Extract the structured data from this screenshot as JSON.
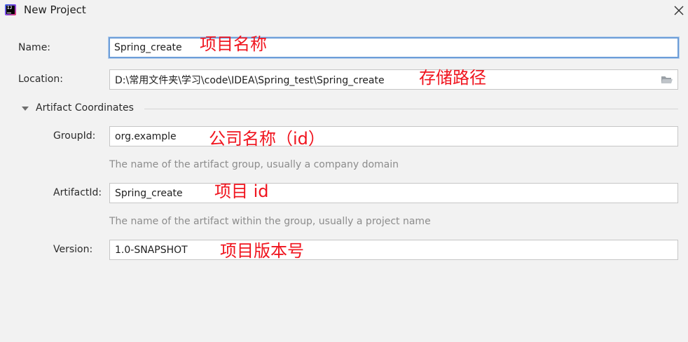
{
  "window": {
    "title": "New Project",
    "app_icon_text": "IJ"
  },
  "form": {
    "name": {
      "label": "Name:",
      "value": "Spring_create"
    },
    "location": {
      "label": "Location:",
      "value": "D:\\常用文件夹\\学习\\code\\IDEA\\Spring_test\\Spring_create"
    },
    "artifact_section": {
      "title": "Artifact Coordinates",
      "expanded": true,
      "group_id": {
        "label": "GroupId:",
        "value": "org.example",
        "hint": "The name of the artifact group, usually a company domain"
      },
      "artifact_id": {
        "label": "ArtifactId:",
        "value": "Spring_create",
        "hint": "The name of the artifact within the group, usually a project name"
      },
      "version": {
        "label": "Version:",
        "value": "1.0-SNAPSHOT"
      }
    }
  },
  "annotations": {
    "name": "项目名称",
    "location": "存储路径",
    "group_id": "公司名称（id）",
    "artifact_id": "项目 id",
    "version": "项目版本号"
  },
  "colors": {
    "annotation": "#f0141e",
    "focus_border": "#6d9ed8",
    "hint_text": "#8c8c8c",
    "background": "#f2f2f2"
  },
  "icons": {
    "app": "intellij-idea-icon",
    "close": "close-icon",
    "folder": "folder-open-icon",
    "section_toggle": "triangle-down-icon"
  }
}
